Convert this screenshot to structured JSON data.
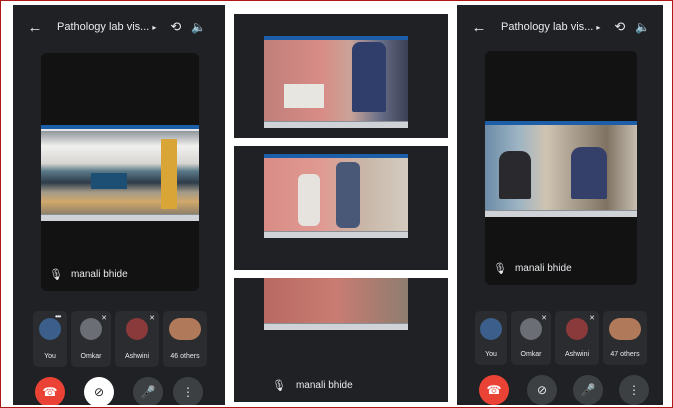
{
  "meeting": {
    "title": "Pathology lab vis...",
    "back_icon": "←",
    "caret_icon": "▸",
    "switch_camera_icon": "⟲",
    "speaker_icon": "🔈"
  },
  "main_tile": {
    "participant_name": "manali bhide",
    "mic_off_icon": "🎙"
  },
  "participants_left": [
    {
      "label": "You",
      "color": "#3b5f8a"
    },
    {
      "label": "Omkar",
      "color": "#6b6e74"
    },
    {
      "label": "Ashwini",
      "color": "#8a3a3a"
    },
    {
      "label": "46 others",
      "color": "#b07a5a"
    }
  ],
  "participants_right": [
    {
      "label": "You",
      "color": "#3b5f8a"
    },
    {
      "label": "Omkar",
      "color": "#6b6e74"
    },
    {
      "label": "Ashwini",
      "color": "#8a3a3a"
    },
    {
      "label": "47 others",
      "color": "#b07a5a"
    }
  ],
  "controls": {
    "end_call_icon": "☎",
    "camera_off_icon": "⊘",
    "mic_icon": "🎤",
    "more_icon": "⋮"
  },
  "middle_panel": {
    "participant_name": "manali bhide"
  },
  "colors": {
    "background": "#202124",
    "end_call": "#ea4335",
    "frame_border": "#b01818"
  }
}
